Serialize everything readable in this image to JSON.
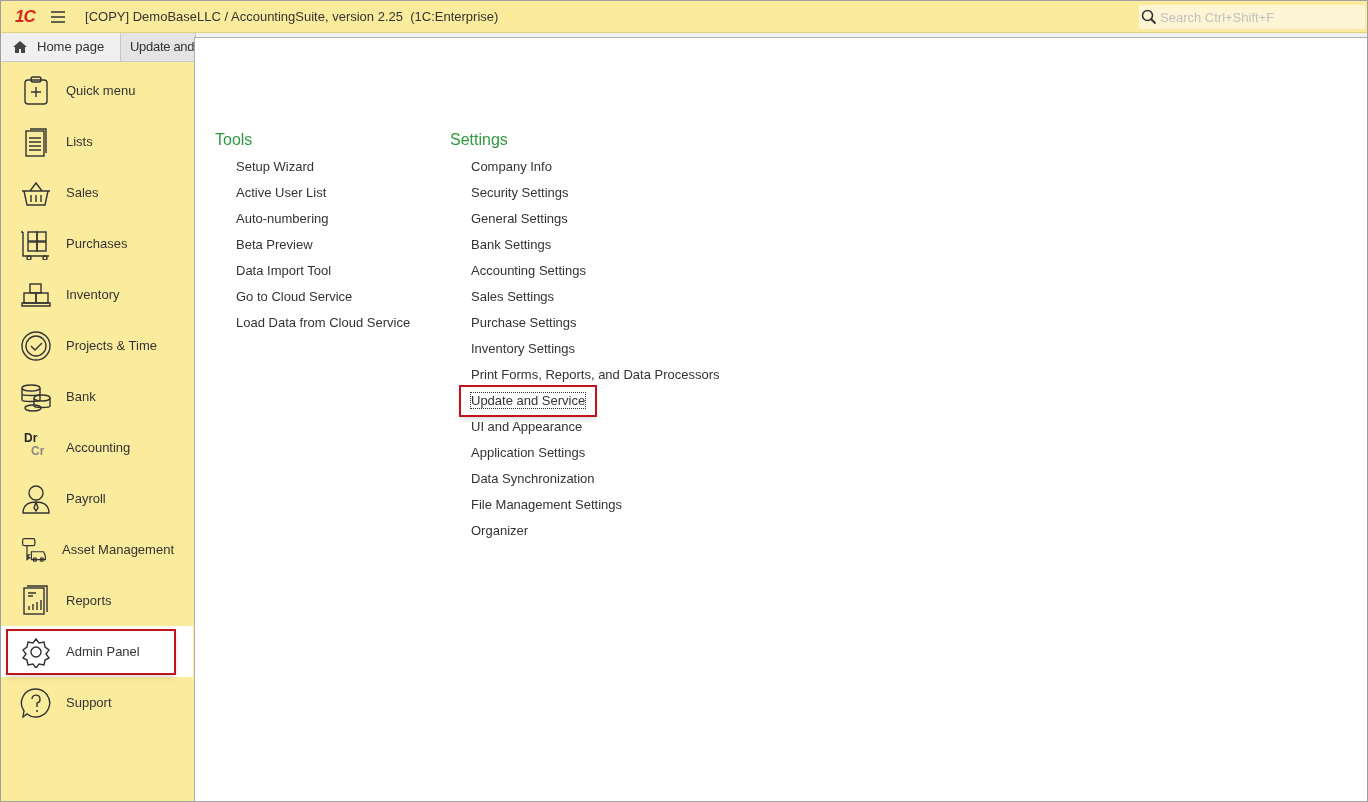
{
  "title_bar": {
    "logo": "1С",
    "title": "[COPY] DemoBaseLLC / AccountingSuite, version 2.25  (1C:Enterprise)",
    "search": {
      "placeholder": "Search Ctrl+Shift+F"
    }
  },
  "tabs": [
    {
      "label": "Home page",
      "selected": false
    },
    {
      "label": "Update and",
      "selected": true
    }
  ],
  "sidebar": {
    "items": [
      {
        "label": "Quick menu",
        "selected": false
      },
      {
        "label": "Lists",
        "selected": false
      },
      {
        "label": "Sales",
        "selected": false
      },
      {
        "label": "Purchases",
        "selected": false
      },
      {
        "label": "Inventory",
        "selected": false
      },
      {
        "label": "Projects & Time",
        "selected": false
      },
      {
        "label": "Bank",
        "selected": false
      },
      {
        "label": "Accounting",
        "selected": false,
        "icon_text": [
          "Dr",
          "Cr"
        ]
      },
      {
        "label": "Payroll",
        "selected": false
      },
      {
        "label": "Asset Management",
        "selected": false
      },
      {
        "label": "Reports",
        "selected": false
      },
      {
        "label": "Admin Panel",
        "selected": true
      },
      {
        "label": "Support",
        "selected": false
      }
    ]
  },
  "sections": [
    {
      "heading": "Tools",
      "links": [
        {
          "label": "Setup Wizard",
          "focused": false
        },
        {
          "label": "Active User List",
          "focused": false
        },
        {
          "label": "Auto-numbering",
          "focused": false
        },
        {
          "label": "Beta Preview",
          "focused": false
        },
        {
          "label": "Data Import Tool",
          "focused": false
        },
        {
          "label": "Go to Cloud Service",
          "focused": false
        },
        {
          "label": "Load Data from Cloud Service",
          "focused": false
        }
      ]
    },
    {
      "heading": "Settings",
      "links": [
        {
          "label": "Company Info",
          "focused": false
        },
        {
          "label": "Security Settings",
          "focused": false
        },
        {
          "label": "General Settings",
          "focused": false
        },
        {
          "label": "Bank Settings",
          "focused": false
        },
        {
          "label": "Accounting Settings",
          "focused": false
        },
        {
          "label": "Sales Settings",
          "focused": false
        },
        {
          "label": "Purchase Settings",
          "focused": false
        },
        {
          "label": "Inventory Settings",
          "focused": false
        },
        {
          "label": "Print Forms, Reports, and Data Processors",
          "focused": false
        },
        {
          "label": "Update and Service",
          "focused": true
        },
        {
          "label": "UI and Appearance",
          "focused": false
        },
        {
          "label": "Application Settings",
          "focused": false
        },
        {
          "label": "Data Synchronization",
          "focused": false
        },
        {
          "label": "File Management Settings",
          "focused": false
        },
        {
          "label": "Organizer",
          "focused": false
        }
      ]
    }
  ]
}
